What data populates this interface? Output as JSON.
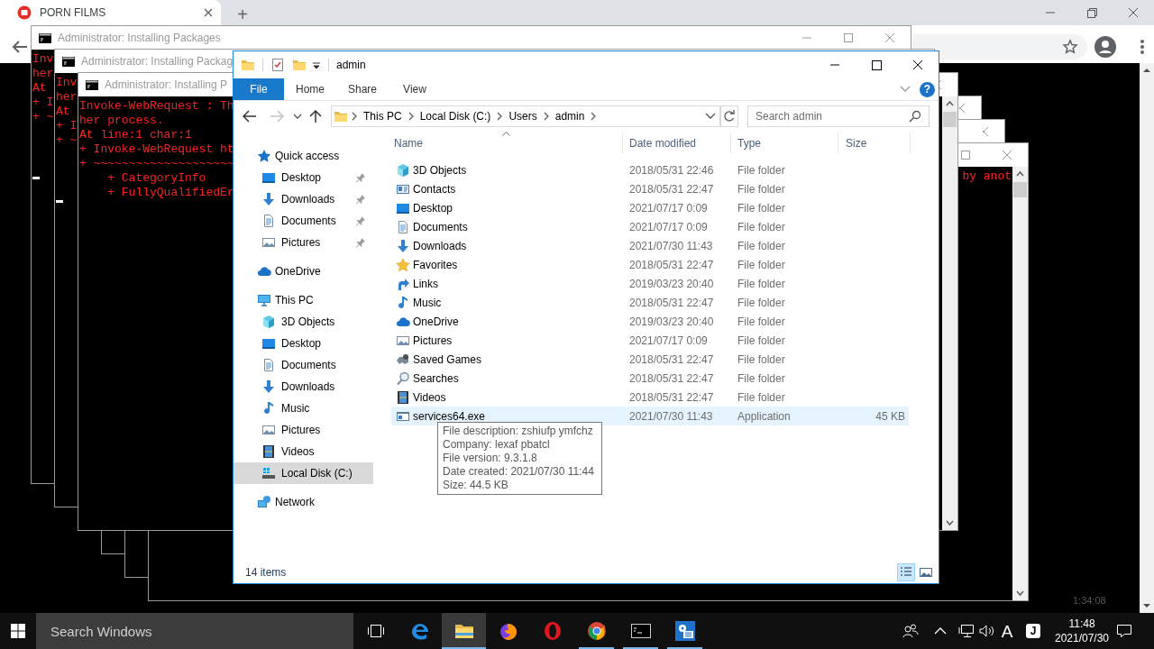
{
  "browser": {
    "tab_title": "PORN FILMS",
    "new_tab": "+",
    "video_time": "1:34:08"
  },
  "consoles": [
    {
      "title": "Administrator: Installing Packages",
      "lines": [
        "Inv",
        "her",
        "At",
        "+ I",
        "+ ~"
      ],
      "cursor": true
    },
    {
      "title": "Administrator: Installing Packag",
      "lines": [
        "Inv",
        "her",
        "At",
        "+ I",
        "+ ~"
      ],
      "cursor": true
    },
    {
      "title": "Administrator: Installing P",
      "lines": [
        "Invoke-WebRequest : Th",
        "her process.",
        "At line:1 char:1",
        "+ Invoke-WebRequest ht",
        "+ ~~~~~~~~~~~~~~~~~~~~",
        "    + CategoryInfo",
        "    + FullyQualifiedEr"
      ],
      "cursor": false
    },
    {
      "cursor": false
    },
    {
      "cursor": false
    },
    {
      "lines": [
        "by anot"
      ],
      "cursor": false
    }
  ],
  "explorer": {
    "title": "admin",
    "ribbon_tabs": [
      {
        "label": "File",
        "kind": "menu"
      },
      {
        "label": "Home",
        "kind": "tab"
      },
      {
        "label": "Share",
        "kind": "tab"
      },
      {
        "label": "View",
        "kind": "tab"
      }
    ],
    "help": "?",
    "address": [
      "This PC",
      "Local Disk (C:)",
      "Users",
      "admin"
    ],
    "search_placeholder": "Search admin",
    "nav": [
      {
        "label": "Quick access",
        "kind": "quick",
        "selected": false,
        "children": [
          {
            "label": "Desktop",
            "kind": "desktop",
            "pinned": true,
            "selected": false
          },
          {
            "label": "Downloads",
            "kind": "downloads",
            "pinned": true,
            "selected": false
          },
          {
            "label": "Documents",
            "kind": "documents",
            "pinned": true,
            "selected": false
          },
          {
            "label": "Pictures",
            "kind": "pictures",
            "pinned": true,
            "selected": false
          }
        ]
      },
      {
        "label": "OneDrive",
        "kind": "cloud",
        "selected": false
      },
      {
        "label": "This PC",
        "kind": "pc",
        "selected": false,
        "children": [
          {
            "label": "3D Objects",
            "kind": "cube",
            "selected": false
          },
          {
            "label": "Desktop",
            "kind": "desktop",
            "selected": false
          },
          {
            "label": "Documents",
            "kind": "documents",
            "selected": false
          },
          {
            "label": "Downloads",
            "kind": "downloads",
            "selected": false
          },
          {
            "label": "Music",
            "kind": "music",
            "selected": false
          },
          {
            "label": "Pictures",
            "kind": "pictures",
            "selected": false
          },
          {
            "label": "Videos",
            "kind": "videos",
            "selected": false
          },
          {
            "label": "Local Disk (C:)",
            "kind": "drive",
            "selected": true
          }
        ]
      },
      {
        "label": "Network",
        "kind": "network",
        "selected": false
      }
    ],
    "columns": [
      "Name",
      "Date modified",
      "Type",
      "Size"
    ],
    "files": [
      {
        "name": "3D Objects",
        "kind": "cube",
        "date": "2018/05/31 22:46",
        "type": "File folder",
        "selected": false
      },
      {
        "name": "Contacts",
        "kind": "contacts",
        "date": "2018/05/31 22:47",
        "type": "File folder",
        "selected": false
      },
      {
        "name": "Desktop",
        "kind": "desktop",
        "date": "2021/07/17 0:09",
        "type": "File folder",
        "selected": false
      },
      {
        "name": "Documents",
        "kind": "documents",
        "date": "2021/07/17 0:09",
        "type": "File folder",
        "selected": false
      },
      {
        "name": "Downloads",
        "kind": "downloads",
        "date": "2021/07/30 11:43",
        "type": "File folder",
        "selected": false
      },
      {
        "name": "Favorites",
        "kind": "favorites",
        "date": "2018/05/31 22:47",
        "type": "File folder",
        "selected": false
      },
      {
        "name": "Links",
        "kind": "links",
        "date": "2019/03/23 20:40",
        "type": "File folder",
        "selected": false
      },
      {
        "name": "Music",
        "kind": "music",
        "date": "2018/05/31 22:47",
        "type": "File folder",
        "selected": false
      },
      {
        "name": "OneDrive",
        "kind": "cloud",
        "date": "2019/03/23 20:40",
        "type": "File folder",
        "selected": false
      },
      {
        "name": "Pictures",
        "kind": "pictures",
        "date": "2021/07/17 0:09",
        "type": "File folder",
        "selected": false
      },
      {
        "name": "Saved Games",
        "kind": "games",
        "date": "2018/05/31 22:47",
        "type": "File folder",
        "selected": false
      },
      {
        "name": "Searches",
        "kind": "searches",
        "date": "2018/05/31 22:47",
        "type": "File folder",
        "selected": false
      },
      {
        "name": "Videos",
        "kind": "videos",
        "date": "2018/05/31 22:47",
        "type": "File folder",
        "selected": false
      },
      {
        "name": "services64.exe",
        "kind": "exe",
        "date": "2021/07/30 11:43",
        "type": "Application",
        "size": "45 KB",
        "selected": true
      }
    ],
    "status": "14 items",
    "views": [
      {
        "kind": "details",
        "selected": true
      },
      {
        "kind": "thumbnails",
        "selected": false
      }
    ]
  },
  "tooltip": [
    "File description: zshiufp ymfchz",
    "Company: lexaf pbatcl",
    "File version: 9.3.1.8",
    "Date created: 2021/07/30 11:44",
    "Size: 44.5 KB"
  ],
  "taskbar": {
    "search_placeholder": "Search Windows",
    "apps": [
      {
        "kind": "e-browser",
        "running": false,
        "active": false
      },
      {
        "kind": "folder",
        "running": true,
        "active": true
      },
      {
        "kind": "fox-browser",
        "running": false,
        "active": false
      },
      {
        "kind": "ring-browser",
        "running": false,
        "active": false
      },
      {
        "kind": "wheel-browser",
        "running": true,
        "active": false
      },
      {
        "kind": "console",
        "running": true,
        "active": false
      },
      {
        "kind": "settings",
        "running": true,
        "active": false
      }
    ],
    "ime": "A",
    "ime_badge": "J",
    "time": "11:48",
    "date": "2021/07/30"
  }
}
